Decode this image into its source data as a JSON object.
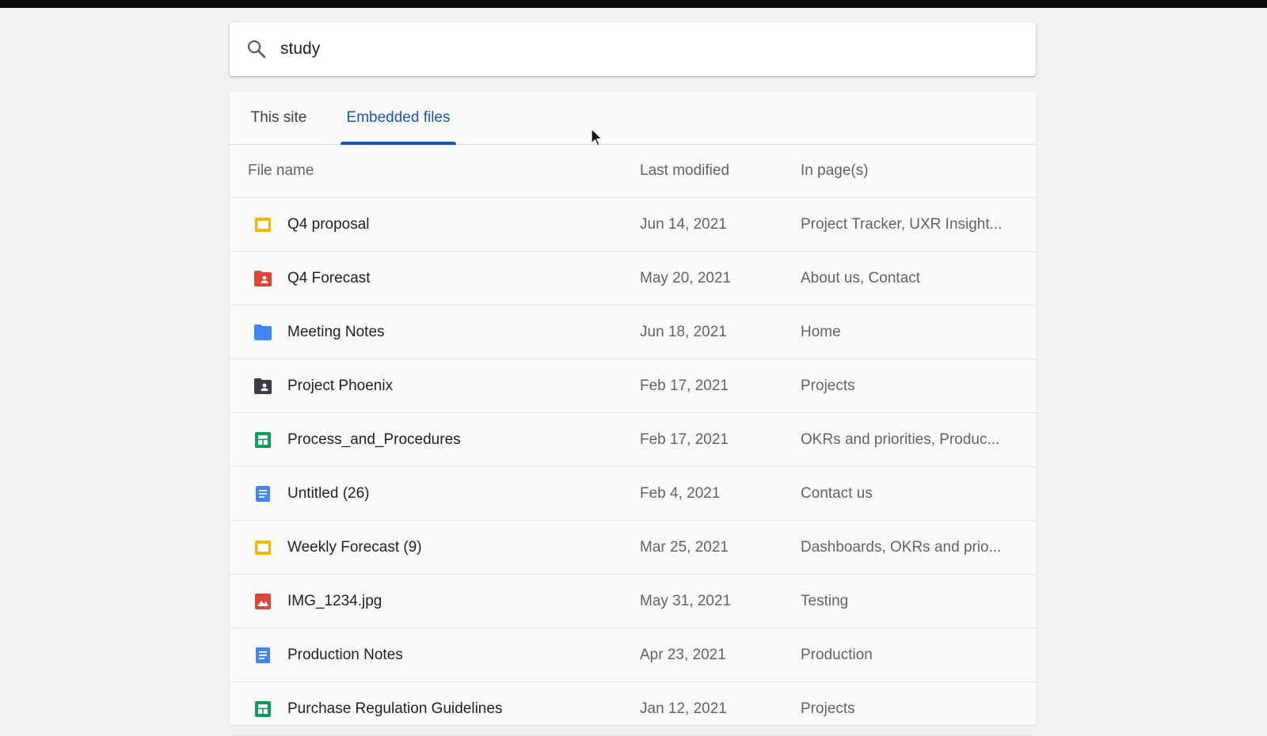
{
  "search": {
    "value": "study",
    "icon": "search-icon"
  },
  "tabs": [
    {
      "label": "This site",
      "active": false
    },
    {
      "label": "Embedded files",
      "active": true
    }
  ],
  "colors": {
    "accent": "#1a56b8",
    "slides": "#f4b400",
    "pdf_red": "#db4437",
    "folder_blue": "#4285f4",
    "shared_folder": "#3c4043",
    "sheets_green": "#0f9d58",
    "docs_blue": "#4285f4",
    "image_red": "#db4437"
  },
  "table": {
    "headers": {
      "name": "File name",
      "modified": "Last modified",
      "pages": "In page(s)"
    },
    "rows": [
      {
        "icon": "slides-icon",
        "name": "Q4 proposal",
        "modified": "Jun 14, 2021",
        "pages": "Project Tracker, UXR Insight..."
      },
      {
        "icon": "shared-drive-red-icon",
        "name": "Q4 Forecast",
        "modified": "May 20, 2021",
        "pages": "About us, Contact"
      },
      {
        "icon": "folder-icon",
        "name": "Meeting Notes",
        "modified": "Jun 18, 2021",
        "pages": "Home"
      },
      {
        "icon": "shared-folder-icon",
        "name": "Project Phoenix",
        "modified": "Feb 17, 2021",
        "pages": "Projects"
      },
      {
        "icon": "sheets-icon",
        "name": "Process_and_Procedures",
        "modified": "Feb 17, 2021",
        "pages": "OKRs and priorities, Produc..."
      },
      {
        "icon": "docs-icon",
        "name": "Untitled (26)",
        "modified": "Feb 4, 2021",
        "pages": "Contact us"
      },
      {
        "icon": "slides-icon",
        "name": "Weekly Forecast (9)",
        "modified": "Mar 25, 2021",
        "pages": "Dashboards, OKRs and prio..."
      },
      {
        "icon": "image-icon",
        "name": "IMG_1234.jpg",
        "modified": "May 31, 2021",
        "pages": "Testing"
      },
      {
        "icon": "docs-icon",
        "name": "Production Notes",
        "modified": "Apr 23, 2021",
        "pages": "Production"
      },
      {
        "icon": "sheets-icon",
        "name": "Purchase Regulation Guidelines",
        "modified": "Jan 12, 2021",
        "pages": "Projects"
      }
    ]
  }
}
